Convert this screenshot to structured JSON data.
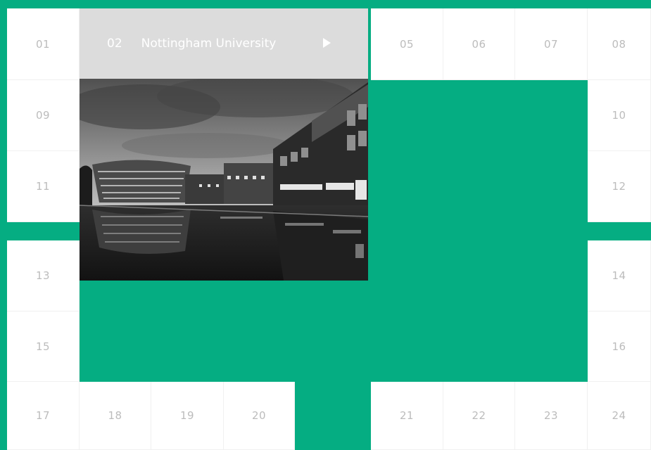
{
  "tiles": {
    "t01": "01",
    "t05": "05",
    "t06": "06",
    "t07": "07",
    "t08": "08",
    "t09": "09",
    "t10": "10",
    "t11": "11",
    "t12": "12",
    "t13": "13",
    "t14": "14",
    "t15": "15",
    "t16": "16",
    "t17": "17",
    "t18": "18",
    "t19": "19",
    "t20": "20",
    "t21": "21",
    "t22": "22",
    "t23": "23",
    "t24": "24"
  },
  "featured": {
    "number": "02",
    "title": "Nottingham University",
    "play_icon": "play-triangle-icon"
  },
  "colors": {
    "accent": "#05ad82",
    "tile": "#ffffff",
    "tile_text": "#bcbcbc",
    "featured_bar": "#dcdcdc"
  }
}
